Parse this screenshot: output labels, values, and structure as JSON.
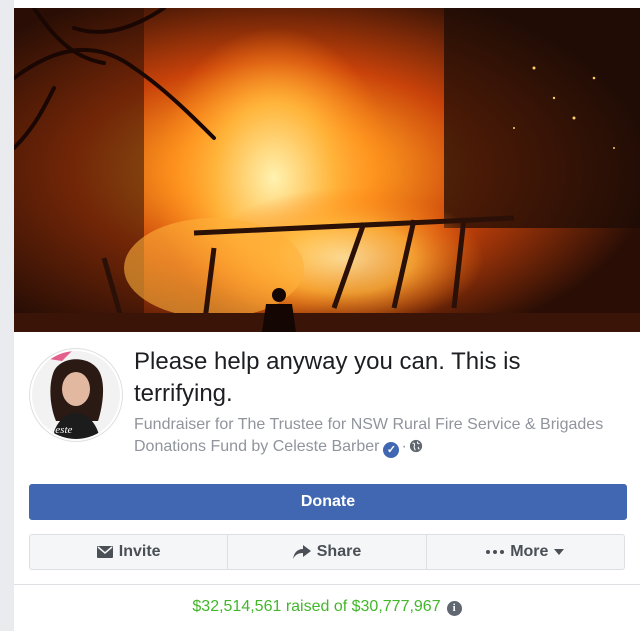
{
  "fundraiser": {
    "title": "Please help anyway you can. This is terrifying.",
    "subtitle": "Fundraiser for The Trustee for NSW Rural Fire Service & Brigades Donations Fund by Celeste Barber",
    "avatar_caption": "Celeste",
    "cover_icon": "bushfire-photo",
    "verified_icon": "verified-badge-icon",
    "privacy_icon": "globe-icon"
  },
  "actions": {
    "donate_label": "Donate",
    "invite_label": "Invite",
    "share_label": "Share",
    "more_label": "More"
  },
  "progress": {
    "raised_text": "$32,514,561 raised of $30,777,967"
  },
  "colors": {
    "accent": "#4267b2",
    "raised_green": "#42b72a",
    "muted_text": "#90949c"
  }
}
